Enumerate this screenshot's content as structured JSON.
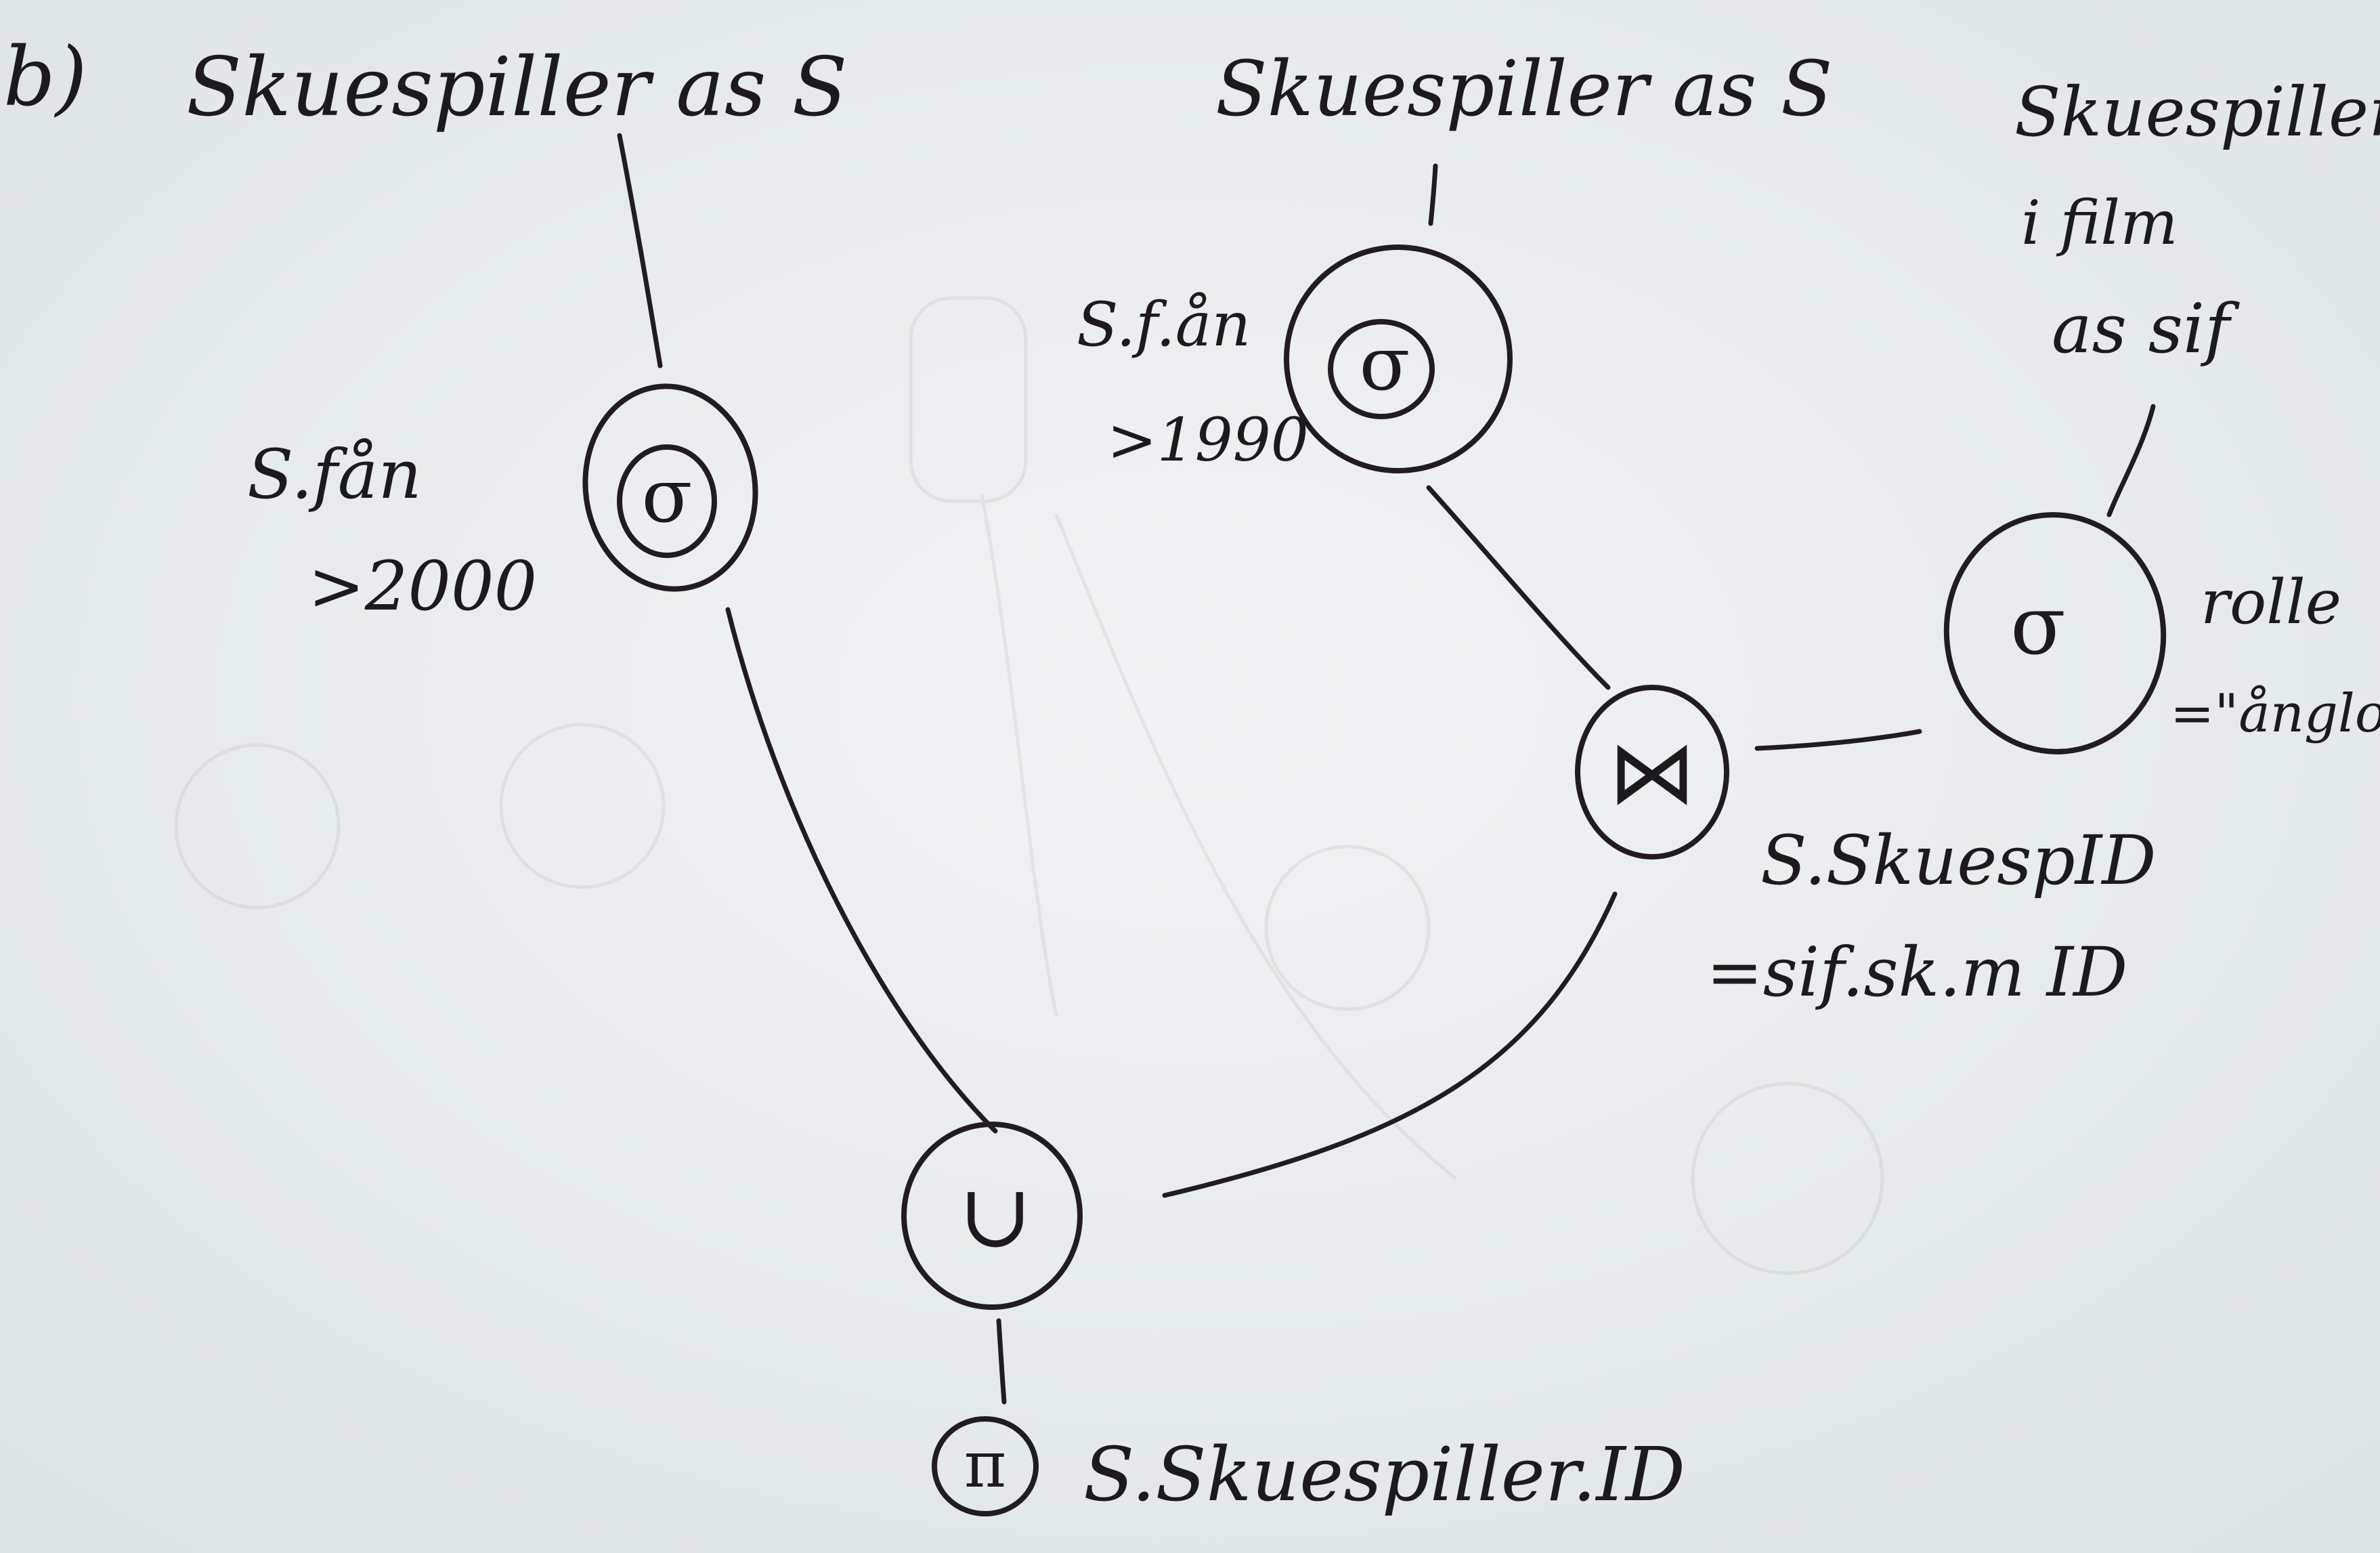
{
  "part_label": "b)",
  "nodes": {
    "select_left": {
      "symbol": "σ",
      "source_label": "Skuespiller as S",
      "condition_lines": [
        "S.fån",
        ">2000"
      ]
    },
    "select_middle": {
      "symbol": "σ",
      "source_label": "Skuespiller as S",
      "condition_lines": [
        "S.f.ån",
        ">1990"
      ]
    },
    "select_right": {
      "symbol": "σ",
      "source_label_lines": [
        "Skuespiller",
        "i film",
        "as sif"
      ],
      "condition_lines": [
        "rolle",
        "=\"ånglom\""
      ]
    },
    "join": {
      "symbol": "⋈",
      "condition_lines": [
        "S.SkuespID",
        "=sif.sk.m ID"
      ]
    },
    "union": {
      "symbol": "∪"
    },
    "project": {
      "symbol": "π",
      "attribute": "S.Skuespiller.ID"
    }
  },
  "colors": {
    "paper": "#e9eeef",
    "ink": "#201c22"
  }
}
